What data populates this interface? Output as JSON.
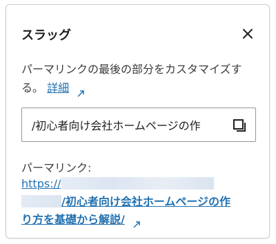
{
  "panel": {
    "title": "スラッグ",
    "description": "パーマリンクの最後の部分をカスタマイズする。",
    "detail_link": "詳細",
    "slug_value": "/初心者向け会社ホームページの作",
    "permalink_label": "パーマリンク:",
    "permalink_prefix": "https://",
    "permalink_slug_line1": "/初心者向け会社ホームページの作",
    "permalink_slug_line2": "り方を基礎から解説/"
  },
  "icons": {
    "close": "close-icon",
    "external": "external-link-icon",
    "copy": "copy-icon"
  },
  "colors": {
    "link": "#2271b1",
    "text": "#1e1e1e",
    "border": "#949494"
  }
}
